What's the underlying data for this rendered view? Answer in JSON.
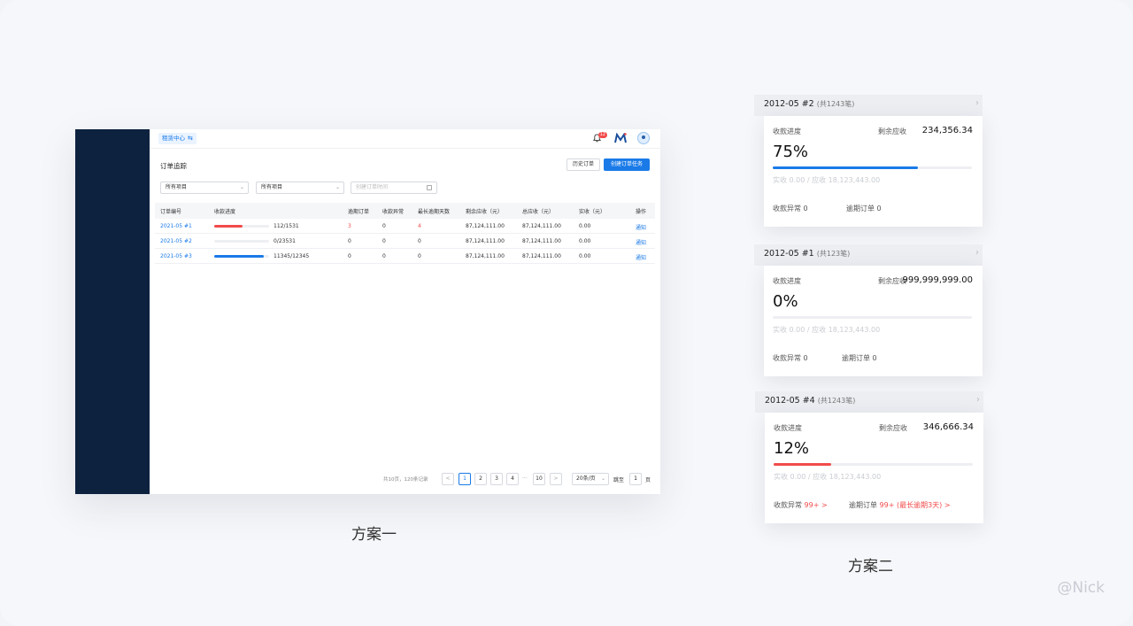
{
  "scheme1": {
    "caption": "方案一",
    "topbar": {
      "workspace": "租赁中心",
      "swap_glyph": "⇆",
      "bell_badge": "12"
    },
    "title": "订单追踪",
    "buttons": {
      "history": "历史订单",
      "create": "创建订单任务"
    },
    "filters": {
      "project1": "所有项目",
      "project2": "所有项目",
      "date_placeholder": "创建订单时间"
    },
    "columns": [
      "订单编号",
      "收款进度",
      "逾期订单",
      "收款异常",
      "最长逾期天数",
      "剩余应收（元）",
      "总应收（元）",
      "实收（元）",
      "操作"
    ],
    "rows": [
      {
        "id": "2021-05 #1",
        "progress": 0.52,
        "progress_color": "#f24b4b",
        "progress_text": "112/1531",
        "overdue": "3",
        "abnormal": "0",
        "max_days": "4",
        "remaining": "87,124,111.00",
        "total": "87,124,111.00",
        "paid": "0.00",
        "action": "通知"
      },
      {
        "id": "2021-05 #2",
        "progress": 0,
        "progress_color": "#1a7ae8",
        "progress_text": "0/23531",
        "overdue": "0",
        "abnormal": "0",
        "max_days": "0",
        "remaining": "87,124,111.00",
        "total": "87,124,111.00",
        "paid": "0.00",
        "action": "通知"
      },
      {
        "id": "2021-05 #3",
        "progress": 0.9,
        "progress_color": "#1a7ae8",
        "progress_text": "11345/12345",
        "overdue": "0",
        "abnormal": "0",
        "max_days": "0",
        "remaining": "87,124,111.00",
        "total": "87,124,111.00",
        "paid": "0.00",
        "action": "通知"
      }
    ],
    "pagination": {
      "summary": "共10页，120条记录",
      "prev": "<",
      "next": ">",
      "pages": [
        "1",
        "2",
        "3",
        "4",
        "···",
        "10"
      ],
      "page_size": "20条/页",
      "jump_label": "跳至",
      "jump_value": "1",
      "page_unit": "页"
    }
  },
  "scheme2": {
    "caption": "方案二",
    "cards": [
      {
        "title": "2012-05 #2",
        "count": "(共1243笔)",
        "progress_label": "收款进度",
        "remain_label": "剩余应收",
        "remain": "234,356.34",
        "percent_text": "75%",
        "progress": 0.73,
        "progress_color": "#1a7ae8",
        "paid": "实收 0.00 / 应收 18,123,443.00",
        "abnormal_label": "收款异常",
        "abnormal": "0",
        "overdue_label": "逾期订单",
        "overdue": "0",
        "alert": false
      },
      {
        "title": "2012-05 #1",
        "count": "(共123笔)",
        "progress_label": "收款进度",
        "remain_label": "剩余应收",
        "remain": "999,999,999.00",
        "percent_text": "0%",
        "progress": 0,
        "progress_color": "#1a7ae8",
        "paid": "实收 0.00 / 应收 18,123,443.00",
        "abnormal_label": "收款异常",
        "abnormal": "0",
        "overdue_label": "逾期订单",
        "overdue": "0",
        "alert": false
      },
      {
        "title": "2012-05 #4",
        "count": "(共1243笔)",
        "progress_label": "收款进度",
        "remain_label": "剩余应收",
        "remain": "346,666.34",
        "percent_text": "12%",
        "progress": 0.29,
        "progress_color": "#f24b4b",
        "paid": "实收 0.00 / 应收 18,123,443.00",
        "abnormal_label": "收款异常",
        "abnormal": "99+ >",
        "overdue_label": "逾期订单",
        "overdue": "99+ (最长逾期3天) >",
        "alert": true
      }
    ]
  },
  "watermark": "@Nick"
}
